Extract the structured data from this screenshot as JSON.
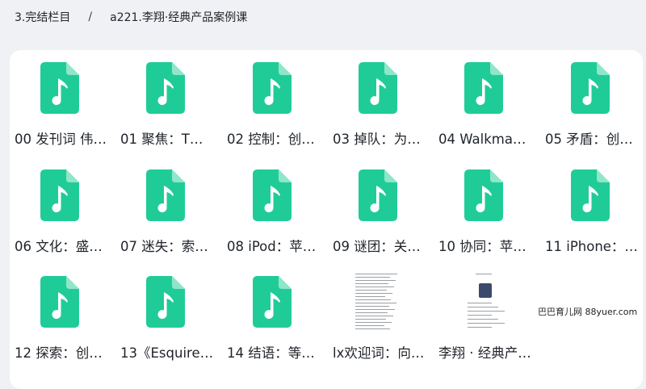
{
  "breadcrumb": {
    "parent": "3.完结栏目",
    "separator": "/",
    "current": "a221.李翔·经典产品案例课"
  },
  "colors": {
    "file_icon": "#1fcc97",
    "background": "#f0f1f4",
    "panel": "#ffffff"
  },
  "files": [
    {
      "name": "00 发刊词 伟…",
      "icon": "audio-file-icon"
    },
    {
      "name": "01 聚焦：T…",
      "icon": "audio-file-icon"
    },
    {
      "name": "02 控制：创…",
      "icon": "audio-file-icon"
    },
    {
      "name": "03 掉队：为…",
      "icon": "audio-file-icon"
    },
    {
      "name": "04 Walkma…",
      "icon": "audio-file-icon"
    },
    {
      "name": "05 矛盾：创…",
      "icon": "audio-file-icon"
    },
    {
      "name": "06 文化：盛…",
      "icon": "audio-file-icon"
    },
    {
      "name": "07 迷失：索…",
      "icon": "audio-file-icon"
    },
    {
      "name": "08 iPod：苹…",
      "icon": "audio-file-icon"
    },
    {
      "name": "09 谜团：关…",
      "icon": "audio-file-icon"
    },
    {
      "name": "10 协同：苹…",
      "icon": "audio-file-icon"
    },
    {
      "name": "11 iPhone：…",
      "icon": "audio-file-icon"
    },
    {
      "name": "12 探索：创…",
      "icon": "audio-file-icon"
    },
    {
      "name": "13《Esquire…",
      "icon": "audio-file-icon"
    },
    {
      "name": "14 结语：等…",
      "icon": "audio-file-icon"
    },
    {
      "name": "lx欢迎词：向…",
      "icon": "document-thumbnail"
    },
    {
      "name": "李翔 · 经典产…",
      "icon": "document-thumbnail-with-photo"
    }
  ],
  "watermark": "巴巴育儿网 88yuer.com"
}
